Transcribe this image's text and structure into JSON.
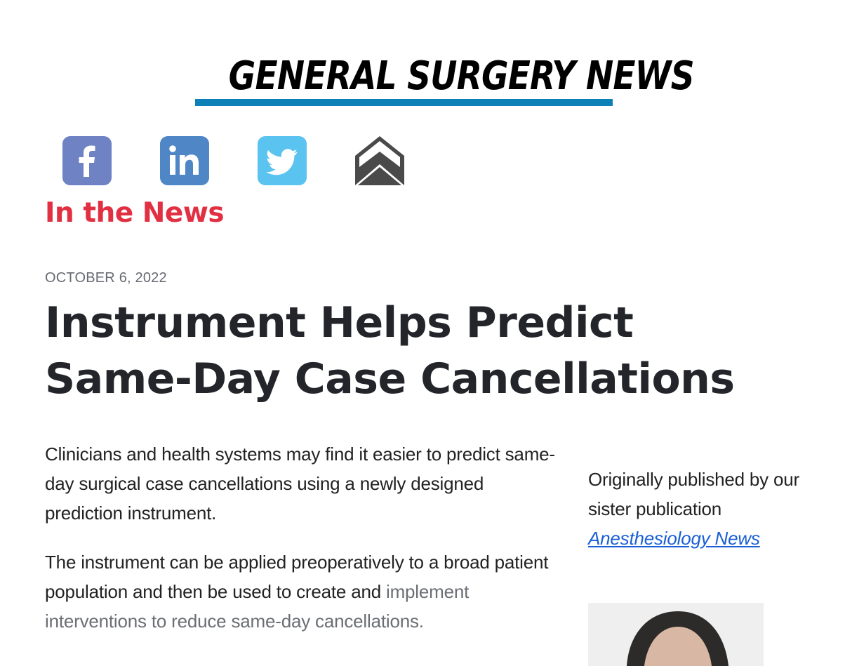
{
  "masthead": {
    "title": "GENERAL SURGERY NEWS",
    "rule_color": "#0d80b8"
  },
  "share": [
    {
      "name": "facebook",
      "icon": "facebook-icon",
      "color": "#6f82c4"
    },
    {
      "name": "linkedin",
      "icon": "linkedin-icon",
      "color": "#4f86c6"
    },
    {
      "name": "twitter",
      "icon": "twitter-icon",
      "color": "#5bc3f0"
    },
    {
      "name": "email",
      "icon": "email-icon",
      "color": "#4a4a4a"
    }
  ],
  "section": {
    "label": "In the News",
    "color": "#e23043"
  },
  "article": {
    "date": "OCTOBER 6, 2022",
    "headline_line1": "Instrument Helps Predict",
    "headline_line2": "Same-Day Case Cancellations",
    "paragraph1": "Clinicians and health systems may find it easier to predict same-day surgical case cancellations using a newly designed prediction instrument.",
    "paragraph2_main": "The instrument can be applied preoperatively to a broad patient population and then be used to create and",
    "paragraph2_faded": "implement interventions to reduce same-day cancellations."
  },
  "sidebar": {
    "note_prefix": "Originally published by our sister publication",
    "link_label": "Anesthesiology News",
    "link_color": "#1a5fd6"
  }
}
